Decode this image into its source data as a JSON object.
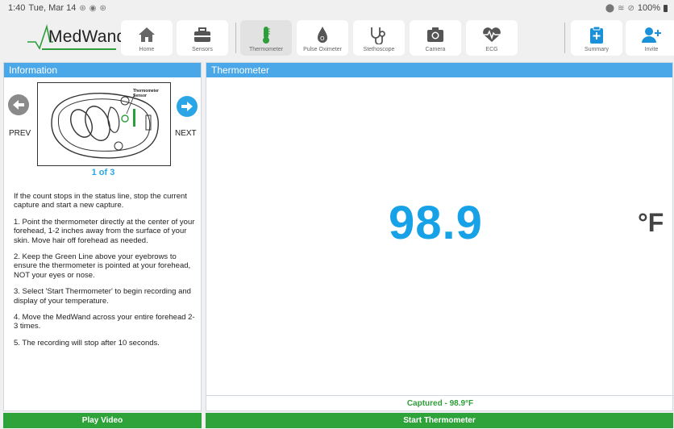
{
  "status_bar": {
    "time": "1:40",
    "date": "Tue, Mar 14",
    "battery": "100%"
  },
  "brand": {
    "name": "MedWand",
    "accent_color": "#2e9e3a"
  },
  "nav": {
    "items": [
      {
        "label": "Home",
        "icon": "home-icon"
      },
      {
        "label": "Sensors",
        "icon": "toolbox-icon"
      },
      {
        "label": "Thermometer",
        "icon": "thermometer-icon",
        "active": true
      },
      {
        "label": "Pulse Oximeter",
        "icon": "pulse-oximeter-icon"
      },
      {
        "label": "Stethoscope",
        "icon": "stethoscope-icon"
      },
      {
        "label": "Camera",
        "icon": "camera-icon"
      },
      {
        "label": "ECG",
        "icon": "ecg-heart-icon"
      },
      {
        "label": "Summary",
        "icon": "clipboard-plus-icon"
      },
      {
        "label": "Invite",
        "icon": "add-user-icon"
      }
    ]
  },
  "info_panel": {
    "title": "Information",
    "diagram_label": "Thermometer Sensor",
    "prev_label": "PREV",
    "next_label": "NEXT",
    "pager": "1 of 3",
    "steps": [
      "If the count stops in the status line, stop the current capture and start a new capture.",
      "1. Point the thermometer directly at the center of your forehead, 1-2 inches away from the surface of your skin. Move hair off forehead as needed.",
      "2. Keep the Green Line above your eyebrows to ensure the thermometer is pointed at your forehead, NOT your eyes or nose.",
      "3. Select 'Start Thermometer' to begin recording and display of your temperature.",
      "4. Move the MedWand across your entire forehead 2-3 times.",
      "5. The recording will stop after 10 seconds."
    ],
    "play_video_label": "Play Video"
  },
  "thermo_panel": {
    "title": "Thermometer",
    "reading": "98.9",
    "unit": "°F",
    "captured_text": "Captured - 98.9°F",
    "start_label": "Start Thermometer"
  },
  "colors": {
    "header_blue": "#4aa8e8",
    "reading_blue": "#17a2e8",
    "button_green": "#2ea33a"
  }
}
